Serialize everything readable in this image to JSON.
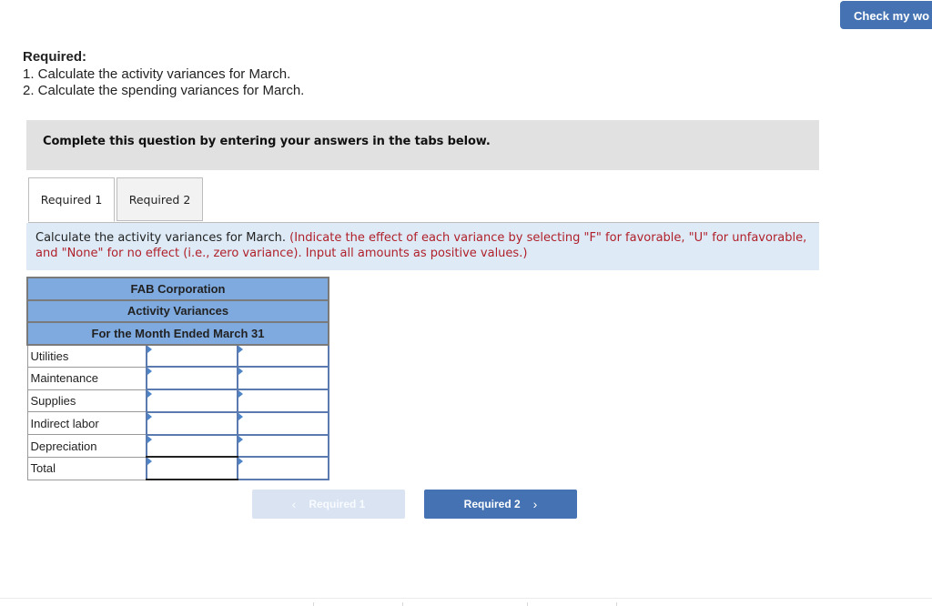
{
  "header": {
    "check_button": "Check my wo"
  },
  "required": {
    "title": "Required:",
    "items": [
      "1. Calculate the activity variances for March.",
      "2. Calculate the spending variances for March."
    ]
  },
  "instruction": "Complete this question by entering your answers in the tabs below.",
  "tabs": [
    {
      "label": "Required 1",
      "active": true
    },
    {
      "label": "Required 2",
      "active": false
    }
  ],
  "prompt": {
    "main": "Calculate the activity variances for March. ",
    "note": "(Indicate the effect of each variance by selecting \"F\" for favorable, \"U\" for unfavorable, and \"None\" for no effect (i.e., zero variance). Input all amounts as positive values.)"
  },
  "table": {
    "headers": [
      "FAB Corporation",
      "Activity Variances",
      "For the Month Ended March 31"
    ],
    "rows": [
      {
        "label": "Utilities",
        "amount": "",
        "effect": ""
      },
      {
        "label": "Maintenance",
        "amount": "",
        "effect": ""
      },
      {
        "label": "Supplies",
        "amount": "",
        "effect": ""
      },
      {
        "label": "Indirect labor",
        "amount": "",
        "effect": ""
      },
      {
        "label": "Depreciation",
        "amount": "",
        "effect": ""
      },
      {
        "label": "Total",
        "amount": "",
        "effect": ""
      }
    ]
  },
  "nav": {
    "prev_label": "Required 1",
    "next_label": "Required 2",
    "prev_icon": "‹",
    "next_icon": "›"
  },
  "colors": {
    "accent": "#4472b2",
    "table_header": "#7eaae0",
    "prompt_bg": "#deebf7",
    "note_red": "#b0202a"
  }
}
